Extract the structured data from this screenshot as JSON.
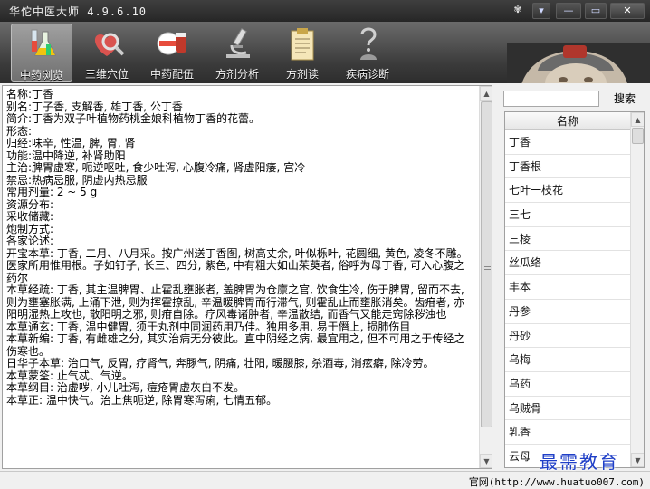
{
  "app": {
    "title": "华佗中医大师 4.9.6.10",
    "window_buttons": {
      "mode": "▾",
      "minimize": "—",
      "maximize": "▭",
      "close": "✕"
    }
  },
  "toolbar": {
    "items": [
      {
        "label": "中药浏览",
        "icon": "flask-icon",
        "active": true
      },
      {
        "label": "三维穴位",
        "icon": "heart-magnifier-icon",
        "active": false
      },
      {
        "label": "中药配伍",
        "icon": "pill-bottle-icon",
        "active": false
      },
      {
        "label": "方剂分析",
        "icon": "microscope-icon",
        "active": false
      },
      {
        "label": "方剂读",
        "icon": "clipboard-icon",
        "active": false
      },
      {
        "label": "疾病诊断",
        "icon": "question-figure-icon",
        "active": false
      }
    ]
  },
  "herb_detail": {
    "lines": [
      "名称:丁香",
      "别名:丁子香, 支解香, 雄丁香, 公丁香",
      "简介:丁香为双子叶植物药桃金娘科植物丁香的花蕾。",
      "形态:",
      "归经:味辛, 性温, 脾, 胃, 肾",
      "功能:温中降逆, 补肾助阳",
      "主治:脾胃虚寒, 呃逆呕吐, 食少吐泻, 心腹冷痛, 肾虚阳痿, 宫冷",
      "禁忌:热病忌服, 阴虚内热忌服",
      "常用剂量: 2 ~ 5 g",
      "资源分布:",
      "采收储藏:",
      "炮制方式:",
      "各家论述:",
      "开宝本草: 丁香, 二月、八月采。按广州送丁香图, 树高丈余, 叶似栎叶, 花圆细, 黄色, 凌冬不雕。医家所用惟用根。子如钉子, 长三、四分, 紫色, 中有粗大如山茱萸者, 俗呼为母丁香, 可入心腹之药尔",
      "本草经疏: 丁香, 其主温脾胃、止霍乱壅胀者, 盖脾胃为仓廪之官, 饮食生冷, 伤于脾胃, 留而不去, 则为壅塞胀满, 上涌下泄, 则为挥霍撩乱, 辛温暖脾胃而行滞气, 则霍乱止而壅胀消矣。齿疳者, 亦阳明湿热上攻也, 散阳明之邪, 则疳自除。疗风毒诸肿者, 辛温散结, 而香气又能走窍除秽浊也",
      "本草通玄: 丁香, 温中健胃, 须于丸剂中同润药用乃佳。独用多用, 易于僭上, 损肺伤目",
      "本草新编: 丁香, 有雌雄之分, 其实治病无分彼此。直中阴经之病, 最宜用之, 但不可用之于传经之伤寒也。",
      "日华子本草: 治口气, 反胃, 疗肾气, 奔豚气, 阴痛, 壮阳, 暖腰膝, 杀酒毒, 消痃癖, 除冷劳。",
      "本草蒙筌: 止气忒、气逆。",
      "本草纲目: 治虚哕, 小儿吐泻, 痘疮胃虚灰白不发。",
      "本草正: 温中快气。治上焦呃逆, 除胃寒泻痢, 七情五郁。"
    ]
  },
  "search": {
    "value": "",
    "button_label": "搜索"
  },
  "herb_list": {
    "header": "名称",
    "items": [
      "丁香",
      "丁香根",
      "七叶一枝花",
      "三七",
      "三棱",
      "丝瓜络",
      "丰本",
      "丹参",
      "丹砂",
      "乌梅",
      "乌药",
      "乌贼骨",
      "乳香",
      "云母"
    ]
  },
  "status": {
    "text": "官网(http://www.huatuo007.com)"
  },
  "watermark": {
    "text": "最需教育"
  },
  "colors": {
    "toolbar_bg": "#3a3a3a",
    "watermark": "#1f3fc7"
  }
}
